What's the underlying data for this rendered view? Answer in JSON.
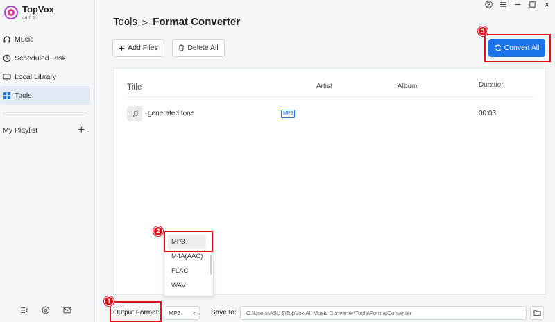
{
  "app": {
    "name": "TopVox",
    "version": "v4.0.7"
  },
  "sidebar": {
    "items": [
      {
        "label": "Music",
        "icon": "headphones-icon"
      },
      {
        "label": "Scheduled Task",
        "icon": "clock-icon"
      },
      {
        "label": "Local Library",
        "icon": "monitor-icon"
      },
      {
        "label": "Tools",
        "icon": "grid-icon",
        "active": true
      }
    ],
    "playlist_label": "My Playlist",
    "playlist_add": "+"
  },
  "header": {
    "breadcrumb_root": "Tools",
    "breadcrumb_sep": ">",
    "breadcrumb_current": "Format Converter"
  },
  "toolbar": {
    "add_files": "Add Files",
    "delete_all": "Delete All",
    "convert_all": "Convert All"
  },
  "table": {
    "columns": {
      "title": "Title",
      "artist": "Artist",
      "album": "Album",
      "duration": "Duration"
    },
    "rows": [
      {
        "title": "generated tone",
        "format": "MP3",
        "duration": "00:03"
      }
    ]
  },
  "dropdown": {
    "options": [
      "MP3",
      "M4A(AAC)",
      "FLAC",
      "WAV"
    ],
    "selected": "MP3"
  },
  "bottom": {
    "output_label": "Output Format:",
    "output_value": "MP3",
    "save_label": "Save to:",
    "save_path": "C:\\Users\\ASUS\\TopVox All Music Converter\\Tools\\FormatConverter"
  },
  "annotations": [
    "1",
    "2",
    "3"
  ],
  "colors": {
    "accent": "#1a73e8",
    "highlight": "#e0121c",
    "active_nav": "#e3ebf6"
  }
}
